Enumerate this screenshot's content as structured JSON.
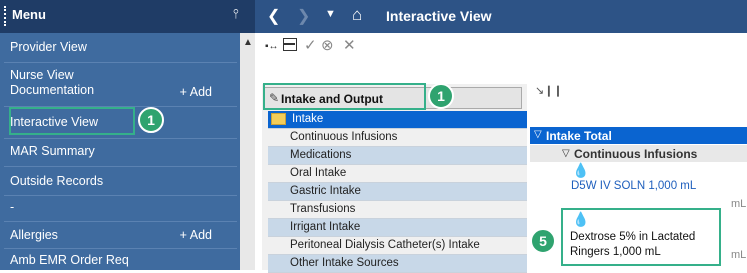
{
  "menu": {
    "title": "Menu",
    "items": [
      {
        "label": "Provider View"
      },
      {
        "label": "Nurse View\nDocumentation",
        "add": "+ Add"
      },
      {
        "label": "Interactive View"
      },
      {
        "label": "MAR Summary"
      },
      {
        "label": "Outside Records"
      },
      {
        "label": "-"
      },
      {
        "label": "Allergies",
        "add": "+ Add"
      },
      {
        "label": "Amb EMR Order Req"
      }
    ]
  },
  "topbar": {
    "title": "Interactive View"
  },
  "navigator": {
    "header": "Intake and Output",
    "rows": [
      "Intake",
      "Continuous Infusions",
      "Medications",
      "Oral Intake",
      "Gastric Intake",
      "Transfusions",
      "Irrigant Intake",
      "Peritoneal Dialysis Catheter(s) Intake",
      "Other Intake Sources"
    ]
  },
  "grid": {
    "intake_total": "Intake Total",
    "continuous_infusions": "Continuous Infusions",
    "drug1": "D5W IV SOLN 1,000 mL",
    "drug2": "Dextrose 5% in Lactated Ringers 1,000 mL",
    "unit": "mL"
  },
  "callouts": {
    "interactive_view_num": "1",
    "nav_header_num": "1",
    "dextrose_num": "5"
  },
  "colors": {
    "accent_green": "#2fa36f",
    "menu_bg": "#3f6b9f",
    "selected_blue": "#0a64d0"
  }
}
